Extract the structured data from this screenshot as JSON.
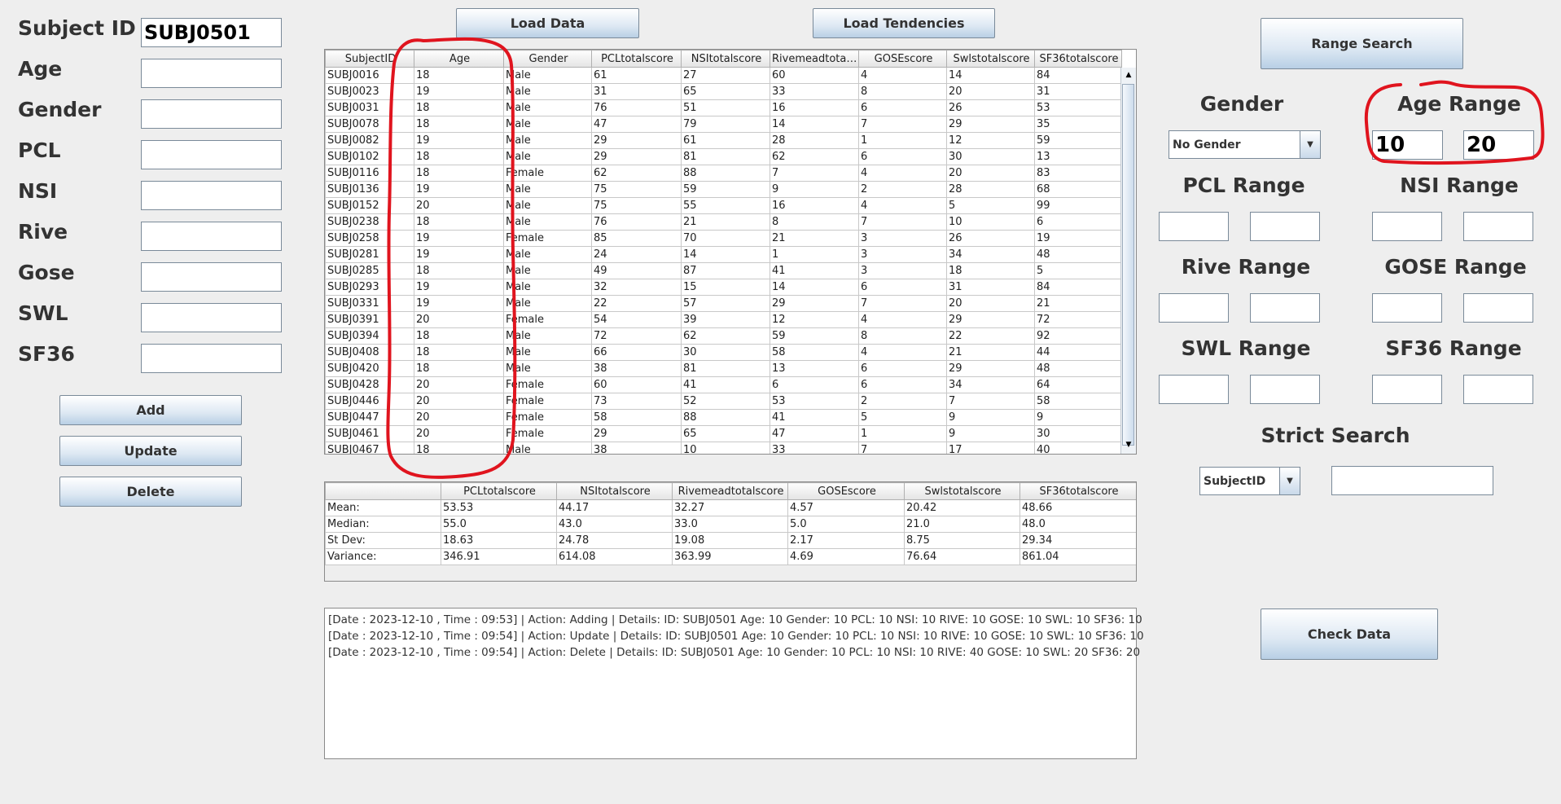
{
  "form": {
    "labels": [
      "Subject ID",
      "Age",
      "Gender",
      "PCL",
      "NSI",
      "Rive",
      "Gose",
      "SWL",
      "SF36"
    ],
    "values": [
      "SUBJ0501",
      "",
      "",
      "",
      "",
      "",
      "",
      "",
      ""
    ]
  },
  "buttons": {
    "add": "Add",
    "update": "Update",
    "delete": "Delete",
    "load_data": "Load Data",
    "load_tendencies": "Load Tendencies",
    "range_search": "Range Search",
    "check_data": "Check Data"
  },
  "table": {
    "columns": [
      "SubjectID",
      "Age",
      "Gender",
      "PCLtotalscore",
      "NSItotalscore",
      "Rivemeadtotal...",
      "GOSEscore",
      "Swlstotalscore",
      "SF36totalscore"
    ],
    "rows": [
      [
        "SUBJ0016",
        "18",
        "Male",
        "61",
        "27",
        "60",
        "4",
        "14",
        "84"
      ],
      [
        "SUBJ0023",
        "19",
        "Male",
        "31",
        "65",
        "33",
        "8",
        "20",
        "31"
      ],
      [
        "SUBJ0031",
        "18",
        "Male",
        "76",
        "51",
        "16",
        "6",
        "26",
        "53"
      ],
      [
        "SUBJ0078",
        "18",
        "Male",
        "47",
        "79",
        "14",
        "7",
        "29",
        "35"
      ],
      [
        "SUBJ0082",
        "19",
        "Male",
        "29",
        "61",
        "28",
        "1",
        "12",
        "59"
      ],
      [
        "SUBJ0102",
        "18",
        "Male",
        "29",
        "81",
        "62",
        "6",
        "30",
        "13"
      ],
      [
        "SUBJ0116",
        "18",
        "Female",
        "62",
        "88",
        "7",
        "4",
        "20",
        "83"
      ],
      [
        "SUBJ0136",
        "19",
        "Male",
        "75",
        "59",
        "9",
        "2",
        "28",
        "68"
      ],
      [
        "SUBJ0152",
        "20",
        "Male",
        "75",
        "55",
        "16",
        "4",
        "5",
        "99"
      ],
      [
        "SUBJ0238",
        "18",
        "Male",
        "76",
        "21",
        "8",
        "7",
        "10",
        "6"
      ],
      [
        "SUBJ0258",
        "19",
        "Female",
        "85",
        "70",
        "21",
        "3",
        "26",
        "19"
      ],
      [
        "SUBJ0281",
        "19",
        "Male",
        "24",
        "14",
        "1",
        "3",
        "34",
        "48"
      ],
      [
        "SUBJ0285",
        "18",
        "Male",
        "49",
        "87",
        "41",
        "3",
        "18",
        "5"
      ],
      [
        "SUBJ0293",
        "19",
        "Male",
        "32",
        "15",
        "14",
        "6",
        "31",
        "84"
      ],
      [
        "SUBJ0331",
        "19",
        "Male",
        "22",
        "57",
        "29",
        "7",
        "20",
        "21"
      ],
      [
        "SUBJ0391",
        "20",
        "Female",
        "54",
        "39",
        "12",
        "4",
        "29",
        "72"
      ],
      [
        "SUBJ0394",
        "18",
        "Male",
        "72",
        "62",
        "59",
        "8",
        "22",
        "92"
      ],
      [
        "SUBJ0408",
        "18",
        "Male",
        "66",
        "30",
        "58",
        "4",
        "21",
        "44"
      ],
      [
        "SUBJ0420",
        "18",
        "Male",
        "38",
        "81",
        "13",
        "6",
        "29",
        "48"
      ],
      [
        "SUBJ0428",
        "20",
        "Female",
        "60",
        "41",
        "6",
        "6",
        "34",
        "64"
      ],
      [
        "SUBJ0446",
        "20",
        "Female",
        "73",
        "52",
        "53",
        "2",
        "7",
        "58"
      ],
      [
        "SUBJ0447",
        "20",
        "Female",
        "58",
        "88",
        "41",
        "5",
        "9",
        "9"
      ],
      [
        "SUBJ0461",
        "20",
        "Female",
        "29",
        "65",
        "47",
        "1",
        "9",
        "30"
      ],
      [
        "SUBJ0467",
        "18",
        "Male",
        "38",
        "10",
        "33",
        "7",
        "17",
        "40"
      ]
    ]
  },
  "stats": {
    "columns": [
      "",
      "PCLtotalscore",
      "NSItotalscore",
      "Rivemeadtotalscore",
      "GOSEscore",
      "Swlstotalscore",
      "SF36totalscore"
    ],
    "rows": [
      [
        "Mean:",
        "53.53",
        "44.17",
        "32.27",
        "4.57",
        "20.42",
        "48.66"
      ],
      [
        "Median:",
        "55.0",
        "43.0",
        "33.0",
        "5.0",
        "21.0",
        "48.0"
      ],
      [
        "St Dev:",
        "18.63",
        "24.78",
        "19.08",
        "2.17",
        "8.75",
        "29.34"
      ],
      [
        "Variance:",
        "346.91",
        "614.08",
        "363.99",
        "4.69",
        "76.64",
        "861.04"
      ]
    ]
  },
  "log": [
    "[Date : 2023-12-10 , Time : 09:53] | Action: Adding | Details: ID: SUBJ0501 Age: 10 Gender: 10 PCL: 10 NSI: 10 RIVE: 10 GOSE: 10 SWL: 10 SF36: 10",
    "[Date : 2023-12-10 , Time : 09:54] | Action: Update | Details: ID: SUBJ0501 Age: 10 Gender: 10 PCL: 10 NSI: 10 RIVE: 10 GOSE: 10 SWL: 10 SF36: 10",
    "[Date : 2023-12-10 , Time : 09:54] | Action: Delete | Details: ID: SUBJ0501 Age: 10 Gender: 10 PCL: 10 NSI: 10 RIVE: 40 GOSE: 10 SWL: 20 SF36: 20"
  ],
  "search": {
    "gender_title": "Gender",
    "gender_value": "No Gender",
    "age_title": "Age Range",
    "age_min": "10",
    "age_max": "20",
    "pcl_title": "PCL Range",
    "nsi_title": "NSI Range",
    "rive_title": "Rive Range",
    "gose_title": "GOSE Range",
    "swl_title": "SWL Range",
    "sf36_title": "SF36 Range",
    "strict_title": "Strict Search",
    "strict_field": "SubjectID",
    "strict_value": ""
  },
  "annotation_color": "#e0141e"
}
